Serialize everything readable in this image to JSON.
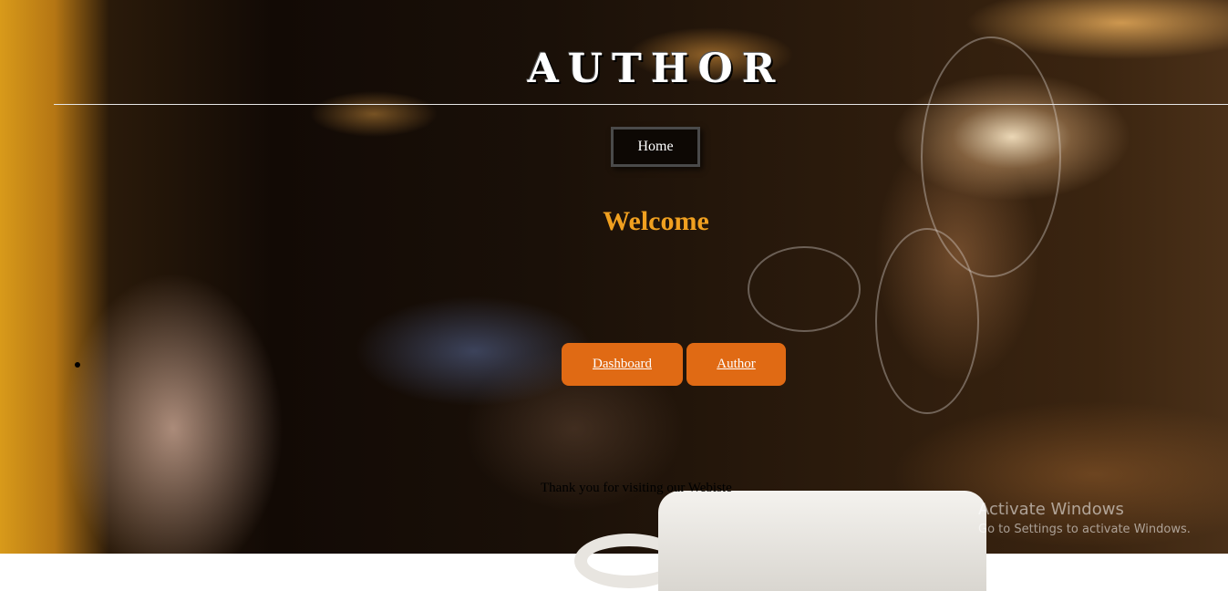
{
  "header": {
    "site_title": "Author"
  },
  "nav": {
    "home_label": "Home"
  },
  "main": {
    "welcome_heading": "Welcome",
    "buttons": [
      {
        "label": "Dashboard"
      },
      {
        "label": "Author"
      }
    ]
  },
  "footer": {
    "thanks_text": "Thank you for visiting our Webiste"
  },
  "os_watermark": {
    "line1": "Activate Windows",
    "line2": "Go to Settings to activate Windows."
  },
  "colors": {
    "accent_orange": "#e06a14",
    "welcome_orange": "#f0a020",
    "nav_bg": "#0d0804"
  }
}
